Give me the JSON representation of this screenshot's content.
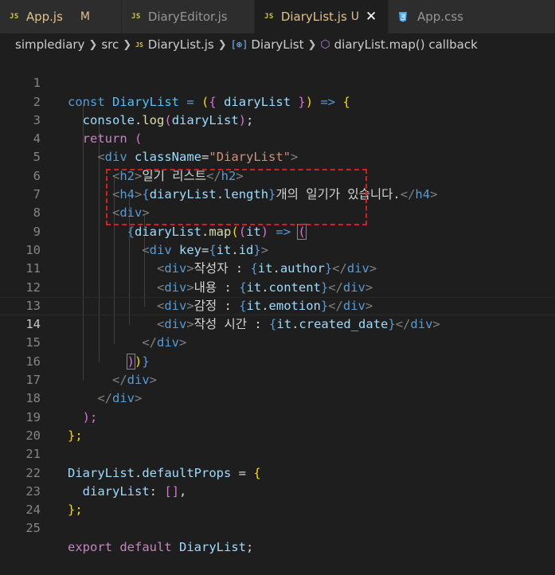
{
  "tabs": [
    {
      "name": "App.js",
      "status": "M",
      "active": false
    },
    {
      "name": "DiaryEditor.js",
      "status": "",
      "active": false
    },
    {
      "name": "DiaryList.js",
      "status": "U",
      "active": true
    },
    {
      "name": "App.css",
      "status": "",
      "active": false
    }
  ],
  "file_icon_text": "JS",
  "close_glyph": "✕",
  "breadcrumb": [
    "simplediary",
    "src",
    "DiaryList.js",
    "DiaryList",
    "diaryList.map() callback"
  ],
  "line_numbers": [
    "1",
    "2",
    "3",
    "4",
    "5",
    "6",
    "7",
    "8",
    "9",
    "10",
    "11",
    "12",
    "13",
    "14",
    "15",
    "16",
    "17",
    "18",
    "19",
    "20",
    "21",
    "22",
    "23",
    "24",
    "25"
  ],
  "current_line": 14,
  "code": {
    "l1": [
      "const",
      "DiaryList",
      "= ",
      "(",
      "{",
      "diaryList",
      "}",
      ")",
      "=>",
      "{"
    ],
    "l2": [
      "console",
      ".",
      "log",
      "(",
      "diaryList",
      ");"
    ],
    "l3": [
      "return",
      "("
    ],
    "l4": [
      "<",
      "div",
      "className",
      "=",
      "\"DiaryList\"",
      ">"
    ],
    "l5": [
      "<",
      "h2",
      ">",
      "일기 리스트",
      "</",
      "h2",
      ">"
    ],
    "l6": [
      "<",
      "h4",
      ">",
      "{",
      "diaryList",
      ".",
      "length",
      "}",
      "개의 일기가 있습니다.",
      "</",
      "h4",
      ">"
    ],
    "l7": [
      "<",
      "div",
      ">"
    ],
    "l8": [
      "{",
      "diaryList",
      ".",
      "map",
      "(",
      "(",
      "it",
      ")",
      "=>",
      "("
    ],
    "l9": [
      "<",
      "div",
      "key",
      "=",
      "{",
      "it",
      ".",
      "id",
      "}",
      ">"
    ],
    "l10": [
      "<",
      "div",
      ">",
      "작성자 : ",
      "{",
      "it",
      ".",
      "author",
      "}",
      "</",
      "div",
      ">"
    ],
    "l11": [
      "<",
      "div",
      ">",
      "내용 : ",
      "{",
      "it",
      ".",
      "content",
      "}",
      "</",
      "div",
      ">"
    ],
    "l12": [
      "<",
      "div",
      ">",
      "감정 : ",
      "{",
      "it",
      ".",
      "emotion",
      "}",
      "</",
      "div",
      ">"
    ],
    "l13": [
      "<",
      "div",
      ">",
      "작성 시간 : ",
      "{",
      "it",
      ".",
      "created_date",
      "}",
      "</",
      "div",
      ">"
    ],
    "l14": [
      "</",
      "div",
      ">"
    ],
    "l15": [
      ")",
      ")",
      "}"
    ],
    "l16": [
      "</",
      "div",
      ">"
    ],
    "l17": [
      "</",
      "div",
      ">"
    ],
    "l18": [
      ");"
    ],
    "l19": [
      "};"
    ],
    "l21": [
      "DiaryList",
      ".",
      "defaultProps",
      " = ",
      "{"
    ],
    "l22": [
      "diaryList",
      ": ",
      "[",
      "]",
      ","
    ],
    "l23": [
      "};"
    ],
    "l25": [
      "export",
      "default",
      "DiaryList",
      ";"
    ]
  },
  "colors": {
    "background": "#1e1e1e",
    "highlight_box": "#e01b1b",
    "modified": "#e2c08d",
    "keyword": "#569cd6",
    "control": "#c586c0",
    "function": "#dcdcaa",
    "variable": "#9cdcfe",
    "string": "#ce9178"
  },
  "icons": [
    "js-file-icon",
    "css-file-icon",
    "close-icon",
    "chevron-right-icon",
    "symbol-variable-icon",
    "symbol-method-icon"
  ]
}
